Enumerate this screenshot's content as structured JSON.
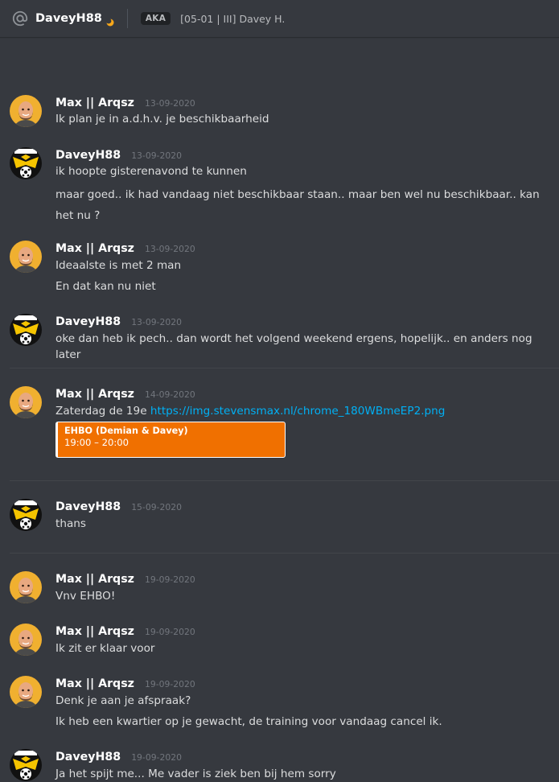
{
  "header": {
    "at_icon": "at-icon",
    "title": "DaveyH88",
    "status_icon": "idle-moon-icon",
    "aka_label": "AKA",
    "nickname": "[05-01 | III] Davey H."
  },
  "colors": {
    "background": "#36393f",
    "username": "#ffffff",
    "timestamp": "#72767d",
    "text": "#dcddde",
    "link": "#00b0f4",
    "event_card": "#f07000",
    "avatar_max_bg": "#f0b030",
    "avatar_davey_bg": "#111111"
  },
  "messages": [
    {
      "author": "Max || Arqsz",
      "avatar": "max-avatar-icon",
      "timestamp": "13-09-2020",
      "lines": [
        "Ik plan je in a.d.h.v. je beschikbaarheid"
      ]
    },
    {
      "author": "DaveyH88",
      "avatar": "vitesse-avatar-icon",
      "timestamp": "13-09-2020",
      "lines": [
        "ik hoopte gisterenavond te kunnen",
        "maar goed.. ik had vandaag niet beschikbaar staan.. maar ben wel nu beschikbaar.. kan het nu ?"
      ]
    },
    {
      "author": "Max || Arqsz",
      "avatar": "max-avatar-icon",
      "timestamp": "13-09-2020",
      "lines": [
        "Ideaalste is met 2 man",
        "En dat kan nu niet"
      ]
    },
    {
      "author": "DaveyH88",
      "avatar": "vitesse-avatar-icon",
      "timestamp": "13-09-2020",
      "lines": [
        "oke dan heb ik pech.. dan wordt het volgend weekend ergens, hopelijk.. en anders nog later"
      ]
    },
    {
      "author": "Max || Arqsz",
      "avatar": "max-avatar-icon",
      "timestamp": "14-09-2020",
      "text_prefix": "Zaterdag de 19e ",
      "link": "https://img.stevensmax.nl/chrome_180WBmeEP2.png",
      "event": {
        "title": "EHBO (Demian & Davey)",
        "time": "19:00 – 20:00"
      }
    },
    {
      "author": "DaveyH88",
      "avatar": "vitesse-avatar-icon",
      "timestamp": "15-09-2020",
      "lines": [
        "thans"
      ]
    },
    {
      "author": "Max || Arqsz",
      "avatar": "max-avatar-icon",
      "timestamp": "19-09-2020",
      "lines": [
        "Vnv EHBO!"
      ]
    },
    {
      "author": "Max || Arqsz",
      "avatar": "max-avatar-icon",
      "timestamp": "19-09-2020",
      "lines": [
        "Ik zit er klaar voor"
      ]
    },
    {
      "author": "Max || Arqsz",
      "avatar": "max-avatar-icon",
      "timestamp": "19-09-2020",
      "lines": [
        "Denk je aan je afspraak?",
        "Ik heb een kwartier op je gewacht, de training voor vandaag cancel ik."
      ]
    },
    {
      "author": "DaveyH88",
      "avatar": "vitesse-avatar-icon",
      "timestamp": "19-09-2020",
      "lines": [
        "Ja het spijt me... Me vader is ziek ben bij hem sorry"
      ]
    }
  ]
}
